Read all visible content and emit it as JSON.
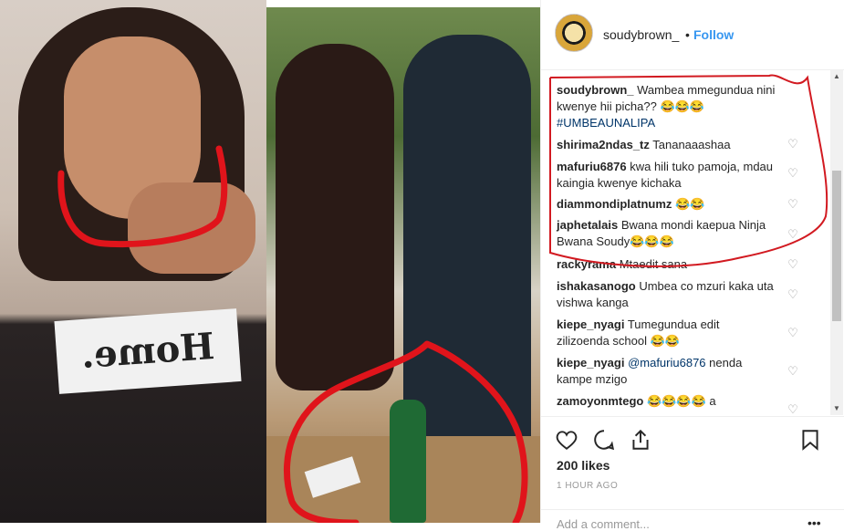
{
  "post": {
    "username": "soudybrown_",
    "separator": "•",
    "follow_label": "Follow",
    "likes": "200 likes",
    "time": "1 HOUR AGO",
    "add_comment_placeholder": "Add a comment...",
    "more": "•••"
  },
  "photo": {
    "shirt_text": "Home."
  },
  "comments": [
    {
      "user": "soudybrown_",
      "text": "Wambea mmegundua nini kwenye hii picha?? 😂😂😂",
      "hashtag": "#UMBEAUNALIPA"
    },
    {
      "user": "shirima2ndas_tz",
      "text": "Tananaaashaa"
    },
    {
      "user": "mafuriu6876",
      "text": "kwa hili tuko pamoja, mdau kaingia kwenye kichaka"
    },
    {
      "user": "diammondiplatnumz",
      "text": "😂😂"
    },
    {
      "user": "japhetalais",
      "text": "Bwana mondi kaepua Ninja Bwana Soudy😂😂😂"
    },
    {
      "user": "rackyrama",
      "text": "Mtaedit sana"
    },
    {
      "user": "ishakasanogo",
      "text": "Umbea co mzuri kaka uta vishwa kanga"
    },
    {
      "user": "kiepe_nyagi",
      "text": "Tumegundua edit zilizoenda school 😂😂"
    },
    {
      "user": "kiepe_nyagi",
      "mention": "@mafuriu6876",
      "text": "nenda kampe mzigo"
    },
    {
      "user": "zamoyonmtego",
      "text": "😂😂😂😂 a"
    }
  ],
  "icons": [
    "heart-icon",
    "comment-icon",
    "share-icon",
    "bookmark-icon"
  ],
  "colors": {
    "accent": "#3897f0",
    "annotation": "#e0141b",
    "text": "#262626"
  }
}
